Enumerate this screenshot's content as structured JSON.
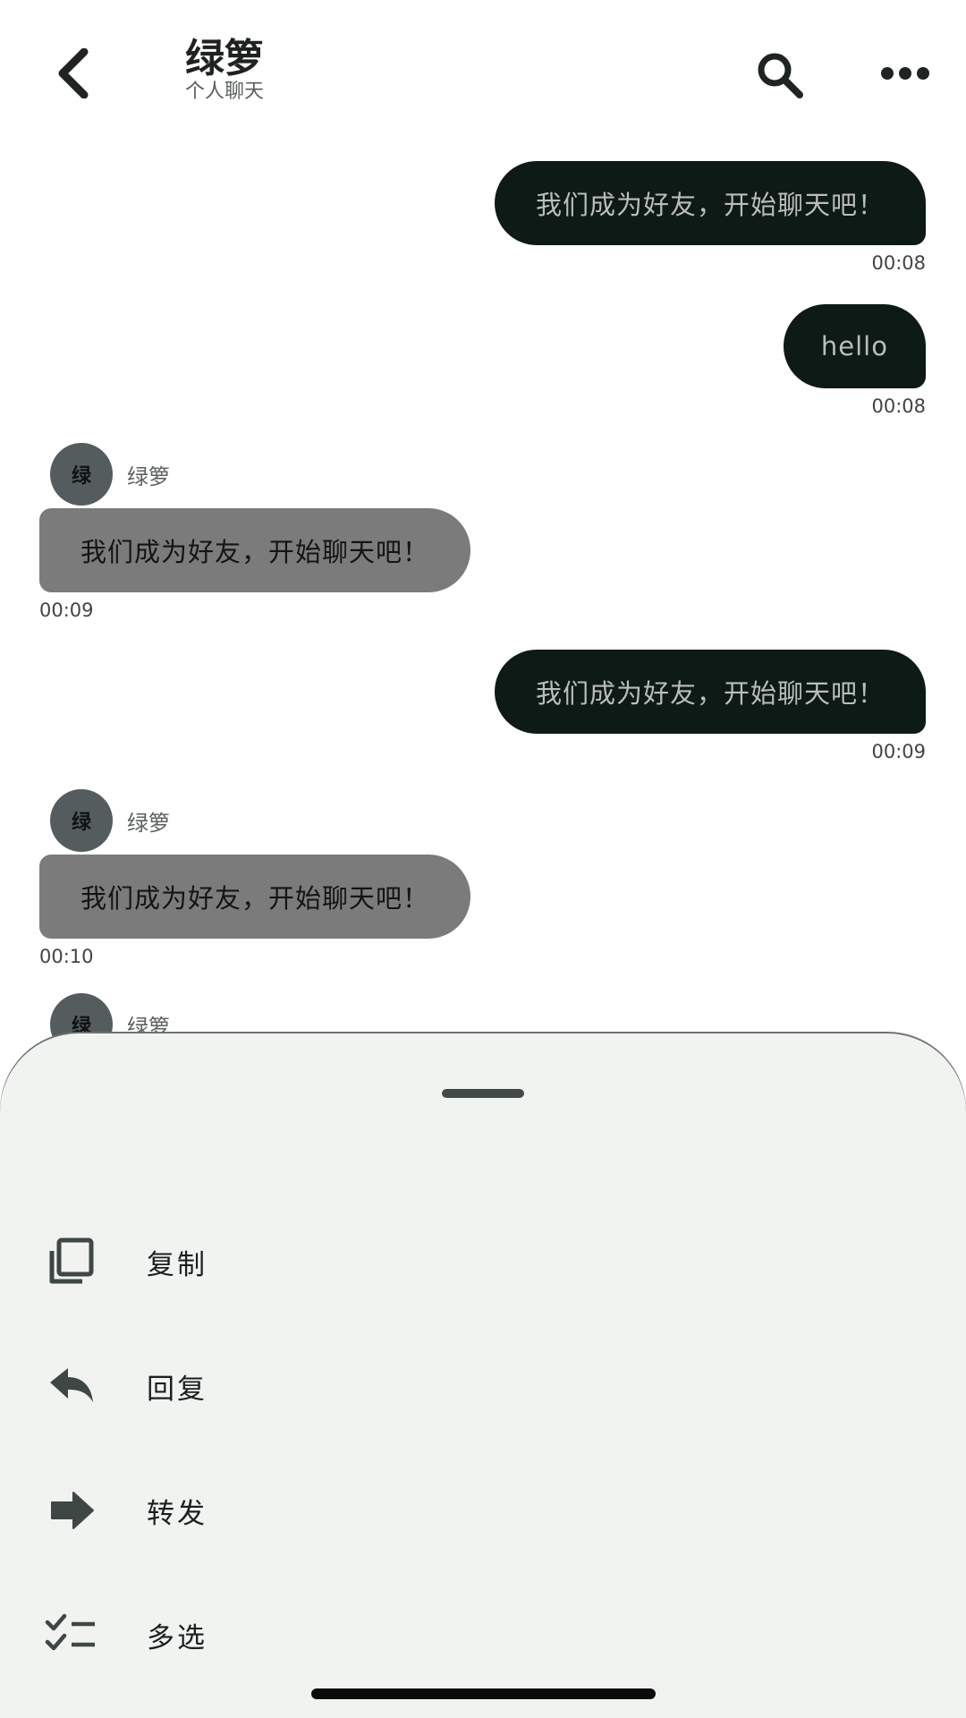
{
  "header": {
    "title": "绿箩",
    "subtitle": "个人聊天"
  },
  "messages": [
    {
      "direction": "out",
      "text": "我们成为好友，开始聊天吧！",
      "time": "00:08"
    },
    {
      "direction": "out",
      "text": "hello",
      "time": "00:08"
    },
    {
      "direction": "in",
      "avatar_text": "绿",
      "sender": "绿箩",
      "text": "我们成为好友，开始聊天吧！",
      "time": "00:09"
    },
    {
      "direction": "out",
      "text": "我们成为好友，开始聊天吧！",
      "time": "00:09"
    },
    {
      "direction": "in",
      "avatar_text": "绿",
      "sender": "绿箩",
      "text": "我们成为好友，开始聊天吧！",
      "time": "00:10"
    },
    {
      "direction": "in",
      "avatar_text": "绿",
      "sender": "绿箩"
    }
  ],
  "sheet": {
    "items": [
      {
        "label": "复制",
        "icon": "copy-icon"
      },
      {
        "label": "回复",
        "icon": "reply-icon"
      },
      {
        "label": "转发",
        "icon": "forward-icon"
      },
      {
        "label": "多选",
        "icon": "multi-select-icon"
      }
    ]
  },
  "colors": {
    "outgoing_bubble": "#0d1a16",
    "incoming_bubble": "#7b7b7b",
    "sheet_background": "#f0f3f0",
    "icon": "#3e4744"
  }
}
